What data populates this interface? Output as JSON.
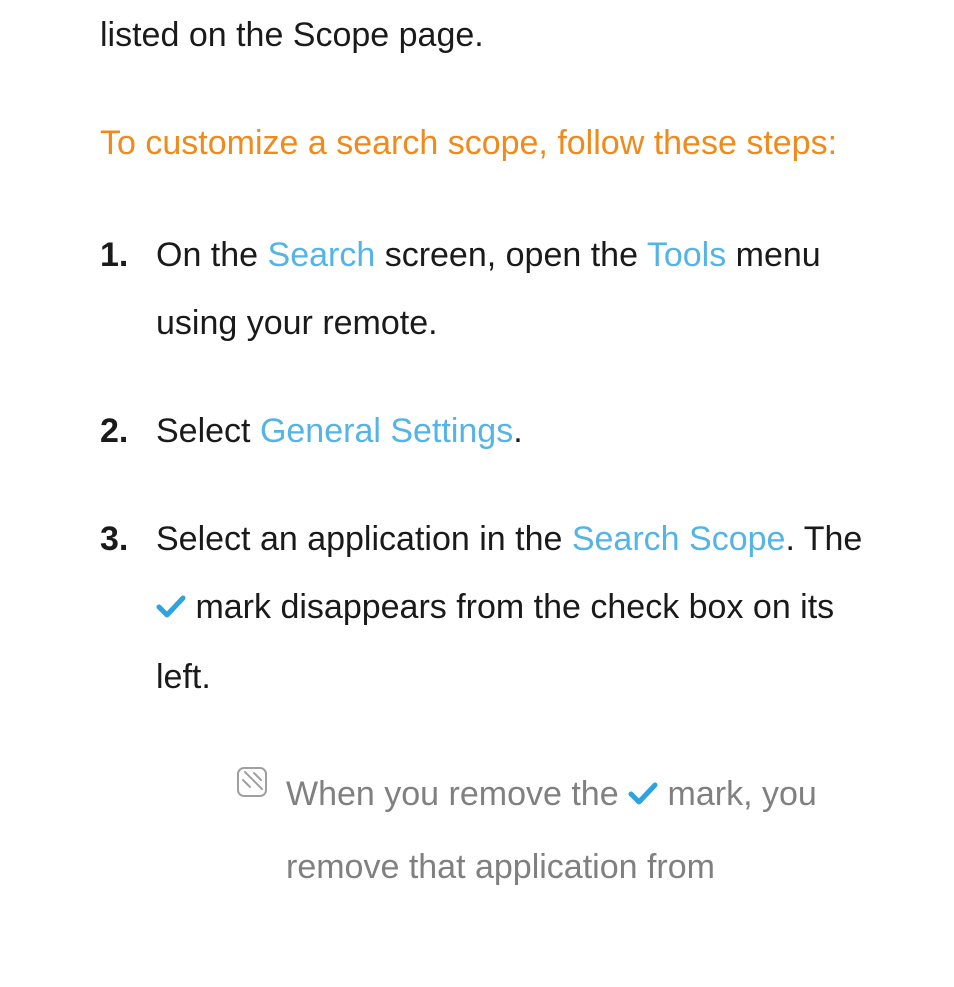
{
  "intro": "listed on the Scope page.",
  "heading": "To customize a search scope, follow these steps:",
  "steps": {
    "s1": {
      "marker": "1.",
      "t1": "On the ",
      "h1": "Search",
      "t2": " screen, open the ",
      "h2": "Tools",
      "t3": " menu using your remote."
    },
    "s2": {
      "marker": "2.",
      "t1": "Select ",
      "h1": "General Settings",
      "t2": "."
    },
    "s3": {
      "marker": "3.",
      "t1": "Select an application in the ",
      "h1": "Search Scope",
      "t2": ". The ",
      "t3": " mark disappears from the check box on its left."
    }
  },
  "note": {
    "t1": "When you remove the ",
    "t2": " mark, you remove that application from"
  }
}
